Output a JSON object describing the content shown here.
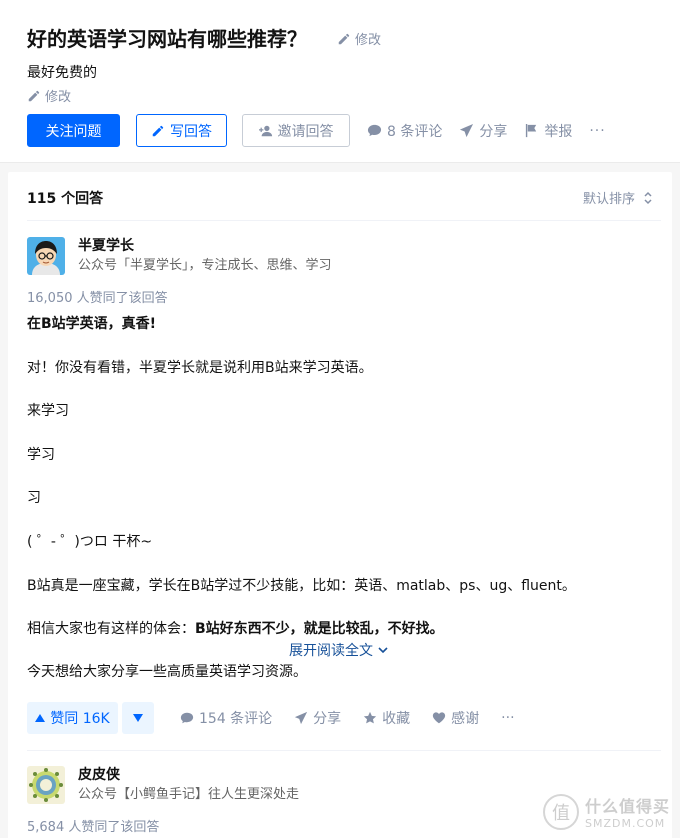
{
  "question": {
    "title": "好的英语学习网站有哪些推荐？",
    "edit_label": "修改",
    "detail": "最好免费的",
    "detail_edit_label": "修改",
    "actions": {
      "follow": "关注问题",
      "write": "写回答",
      "invite": "邀请回答",
      "comments": "8 条评论",
      "share": "分享",
      "report": "举报",
      "more": "···"
    }
  },
  "answers_header": {
    "count": "115 个回答",
    "sort": "默认排序"
  },
  "answer1": {
    "author_name": "半夏学长",
    "author_bio": "公众号「半夏学长」，专注成长、思维、学习",
    "voters": "16,050 人赞同了该回答",
    "p1": "在B站学英语，真香!",
    "p2": "对！你没有看错，半夏学长就是说利用B站来学习英语。",
    "p3": "来学习",
    "p4": "学习",
    "p5": "习",
    "p6": "( ゜- ゜)つロ 干杯~",
    "p7": "B站真是一座宝藏，学长在B站学过不少技能，比如：英语、matlab、ps、ug、fluent。",
    "p8_normal": "相信大家也有这样的体会：",
    "p8_bold": "B站好东西不少，就是比较乱，不好找。",
    "p9": "今天想给大家分享一些高质量英语学习资源。",
    "expand": "展开阅读全文",
    "vote": "赞同 16K",
    "comments": "154 条评论",
    "share": "分享",
    "favorite": "收藏",
    "thanks": "感谢",
    "more": "···"
  },
  "answer2": {
    "author_name": "皮皮侠",
    "author_bio": "公众号【小鳄鱼手记】往人生更深处走",
    "voters": "5,684 人赞同了该回答"
  },
  "watermark": {
    "logo_char": "值",
    "cn": "什么值得买",
    "en": "SMZDM.COM"
  },
  "colors": {
    "primary": "#0066ff",
    "meta": "#8590a6",
    "link": "#175199"
  }
}
